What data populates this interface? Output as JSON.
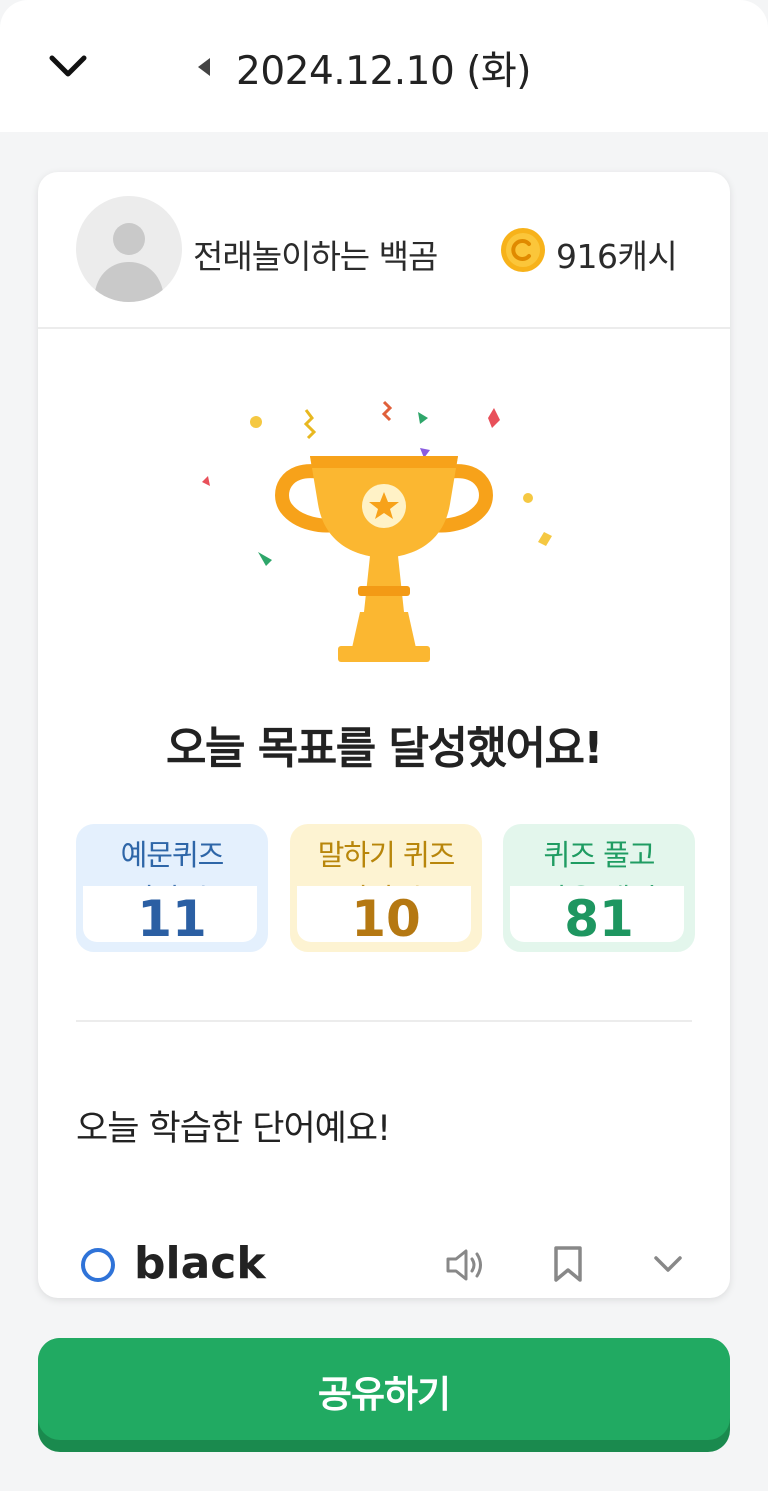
{
  "header": {
    "collapse_icon": "chevron-down-icon",
    "prev_icon": "caret-left-icon",
    "date_title": "2024.12.10 (화)"
  },
  "profile": {
    "nickname": "전래놀이하는 백곰",
    "coin_icon": "coin-icon",
    "cash": "916캐시"
  },
  "goal": {
    "title": "오늘 목표를 달성했어요!"
  },
  "stats": [
    {
      "label": "예문퀴즈",
      "sub": "김장 수",
      "value": "11",
      "color": "#2b5fa3"
    },
    {
      "label": "말하기 퀴즈",
      "sub": "김장 수",
      "value": "10",
      "color": "#b57812"
    },
    {
      "label": "퀴즈 풀고",
      "sub": "받은 캐시",
      "value": "81",
      "color": "#1e9660"
    }
  ],
  "words": {
    "title": "오늘 학습한 단어예요!",
    "items": [
      {
        "word": "black",
        "status_icon": "circle-correct-icon"
      }
    ]
  },
  "share_button": {
    "label": "공유하기",
    "color": "#21aa62"
  }
}
